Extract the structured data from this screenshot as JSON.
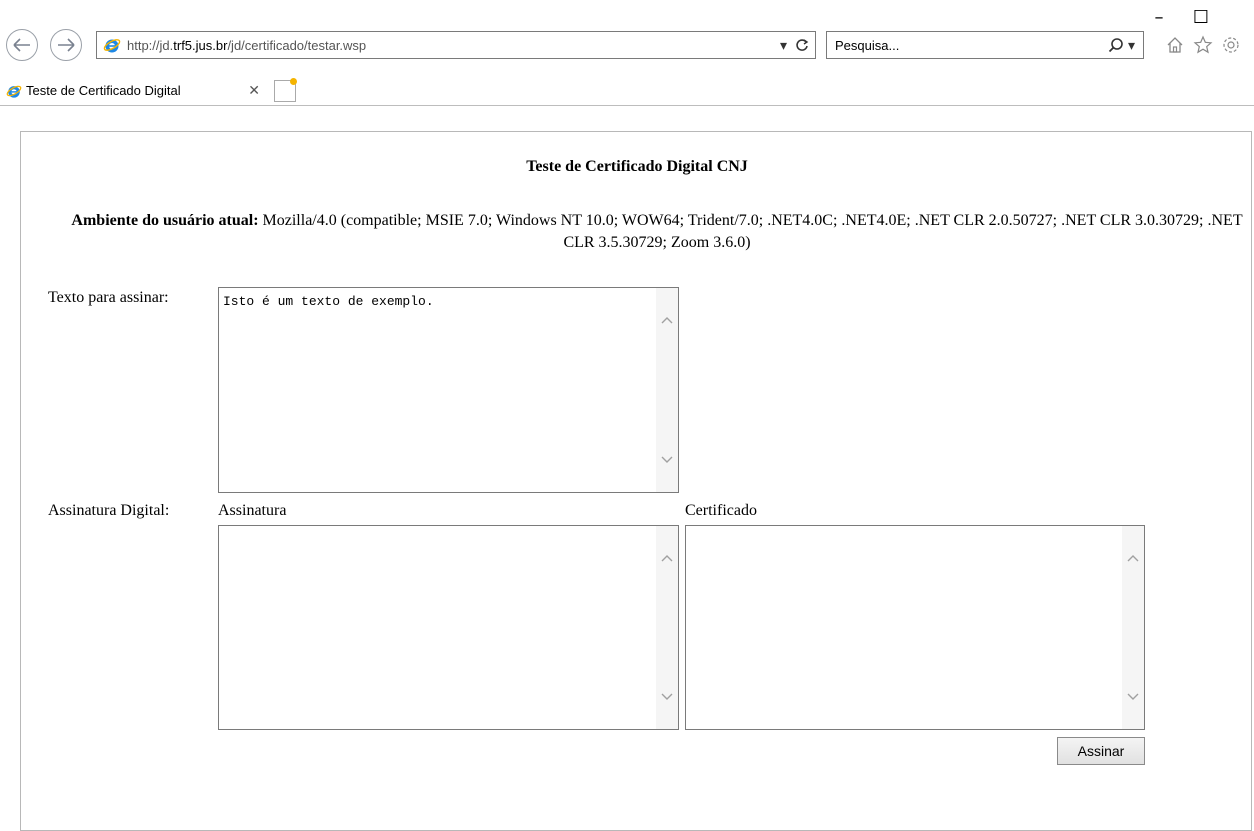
{
  "browser": {
    "url_prefix": "http://jd.",
    "url_domain": "trf5.jus.br",
    "url_path": "/jd/certificado/testar.wsp",
    "search_placeholder": "Pesquisa...",
    "tab_title": "Teste de Certificado Digital",
    "icons": {
      "back": "back-arrow-icon",
      "forward": "forward-arrow-icon",
      "refresh": "refresh-icon",
      "search": "magnifier-icon",
      "home": "home-icon",
      "favorites": "star-icon",
      "tools": "gear-icon"
    },
    "window": {
      "minimize": "–",
      "maximize": "☐"
    }
  },
  "page": {
    "title": "Teste de Certificado Digital CNJ",
    "env_label": "Ambiente do usuário atual:",
    "env_value": "Mozilla/4.0 (compatible; MSIE 7.0; Windows NT 10.0; WOW64; Trident/7.0; .NET4.0C; .NET4.0E; .NET CLR 2.0.50727; .NET CLR 3.0.30729; .NET CLR 3.5.30729; Zoom 3.6.0)",
    "text_label": "Texto para assinar:",
    "text_value": "Isto é um texto de exemplo.",
    "signature_label": "Assinatura Digital:",
    "signature_col_label": "Assinatura",
    "certificate_col_label": "Certificado",
    "signature_value": "",
    "certificate_value": "",
    "sign_button": "Assinar"
  },
  "colors": {
    "ie_blue": "#1e88e5",
    "ie_ring": "#f5b400",
    "border": "#7a7a7a"
  }
}
